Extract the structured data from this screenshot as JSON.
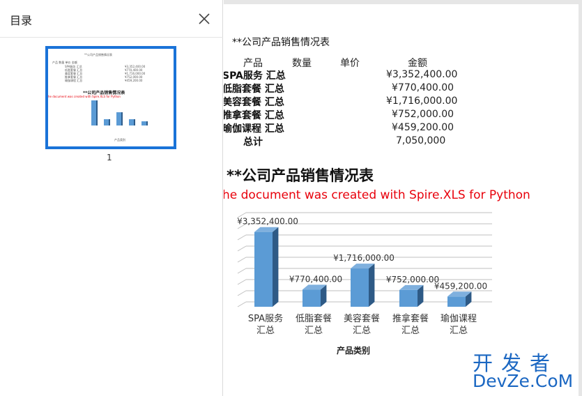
{
  "sidebar": {
    "title": "目录",
    "close_icon": "close-icon",
    "page_number_label": "1"
  },
  "document": {
    "title": "**公司产品销售情况表",
    "table": {
      "headers": [
        "产品",
        "数量",
        "单价",
        "金额"
      ],
      "rows": [
        {
          "label": "SPA服务 汇总",
          "amount": "¥3,352,400.00"
        },
        {
          "label": "低脂套餐 汇总",
          "amount": "¥770,400.00"
        },
        {
          "label": "美容套餐 汇总",
          "amount": "¥1,716,000.00"
        },
        {
          "label": "推拿套餐 汇总",
          "amount": "¥752,000.00"
        },
        {
          "label": "瑜伽课程 汇总",
          "amount": "¥459,200.00"
        }
      ],
      "total_label": "总计",
      "total_value": "7,050,000"
    },
    "chart_title": "**公司产品销售情况表",
    "watermark": "he document was created with  Spire.XLS for Python"
  },
  "chart_data": {
    "type": "bar",
    "title": "**公司产品销售情况表",
    "categories": [
      "SPA服务 汇总",
      "低脂套餐 汇总",
      "美容套餐 汇总",
      "推拿套餐 汇总",
      "瑜伽课程 汇总"
    ],
    "category_lines": [
      [
        "SPA服务",
        "汇总"
      ],
      [
        "低脂套餐",
        "汇总"
      ],
      [
        "美容套餐",
        "汇总"
      ],
      [
        "推拿套餐",
        "汇总"
      ],
      [
        "瑜伽课程",
        "汇总"
      ]
    ],
    "values": [
      3352400,
      770400,
      1716000,
      752000,
      459200
    ],
    "data_labels": [
      "¥3,352,400.00",
      "¥770,400.00",
      "¥1,716,000.00",
      "¥752,000.00",
      "¥459,200.00"
    ],
    "xlabel": "产品类别",
    "ylabel": "",
    "ylim": [
      0,
      4000000
    ],
    "grid": true,
    "colors": {
      "bar_front": "#5b9bd5",
      "bar_side": "#2e5a86",
      "bar_top": "#7fb0de",
      "grid": "#bfbfbf"
    }
  },
  "brand": {
    "line1": "开发者",
    "line2": "DevZe.CoM",
    "color": "#1b67c2"
  },
  "colors": {
    "thumb_border": "#1a73d8",
    "watermark": "#e8000b"
  }
}
